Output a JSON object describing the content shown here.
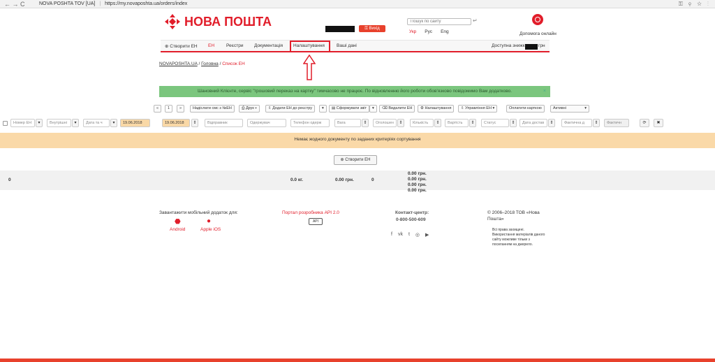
{
  "browser": {
    "nav": "← → C",
    "site_label": "NOVA POSHTA TOV [UA]",
    "url": "https://my.novaposhta.ua/orders/index"
  },
  "header": {
    "logo_text": "НОВА ПОШТА",
    "logout_label": "Вихід",
    "search_placeholder": "Пошук по сайту",
    "langs": [
      "Укр",
      "Рус",
      "Eng"
    ],
    "help_label": "Допомога онлайн"
  },
  "menu": {
    "items": [
      "Створити ЕН",
      "ЕН",
      "Реєстри",
      "Документація",
      "Налаштування",
      "Ваші дані"
    ],
    "balance_label": "Доступна знижка",
    "balance_unit": "грн"
  },
  "breadcrumb": {
    "root": "NOVAPOSHTA.UA",
    "home": "Головна",
    "current": "Список ЕН"
  },
  "alert": {
    "text": "Шановний Клієнте, сервіс \"грошовий переказ на картку\" тимчасово не працює. По відновленню його роботи обов'язково повідомимо Вам додатково.",
    "close": "×"
  },
  "toolbar": {
    "page": "1",
    "prev": "«",
    "next": "»",
    "sms": "Надіслати смс з №ЕН",
    "print": "Друк",
    "add_registry": "Додати ЕН до реєстру",
    "report": "Сформувати звіт",
    "delete": "Видалити ЕН",
    "settings": "Налаштування",
    "manage": "Управління ЕН",
    "pay_card": "Оплатити карткою",
    "status_filter": "Активні"
  },
  "filters": {
    "number": "Номер ЕН",
    "internal": "Внутрішні",
    "date_type": "Дата та ч",
    "date_from": "19.06.2018",
    "date_to": "19.06.2018",
    "sender": "Відправник",
    "recipient": "Одержувач",
    "phone": "Телефон одерж",
    "weight": "Вага",
    "declared": "Оголошен",
    "qty": "Кількість",
    "cost": "Вартість",
    "status": "Статус",
    "delivery_date": "Дата достав",
    "actual": "Фактична д",
    "actual2": "Фактичн"
  },
  "notice": "Немає жодного документу по заданих критеріях сортування",
  "create_button": "Створити ЕН",
  "totals": {
    "count": "0",
    "weight": "0.0 кг.",
    "cost": "0.00 грн.",
    "qty": "0",
    "sum1": "0.00 грн.",
    "sum2": "0.00 грн.",
    "sum3": "0.00 грн.",
    "sum4": "0.00 грн."
  },
  "footer": {
    "mobile_title": "Завантажити мобільний додаток для:",
    "android": "Android",
    "ios": "Apple iOS",
    "api": "Портал розробника API 2.0",
    "contact_title": "Контакт-центр:",
    "phone": "0-800-500-609",
    "copyright": "© 2006–2018 ТОВ «Нова Пошта»",
    "rights": "Всі права захищені. Використання матеріалів даного сайту можливе тільки з посиланням на джерело."
  },
  "colors": {
    "brand_red": "#e11d2a",
    "alert_green": "#7bc67e",
    "notice_orange": "#fad9a8"
  }
}
